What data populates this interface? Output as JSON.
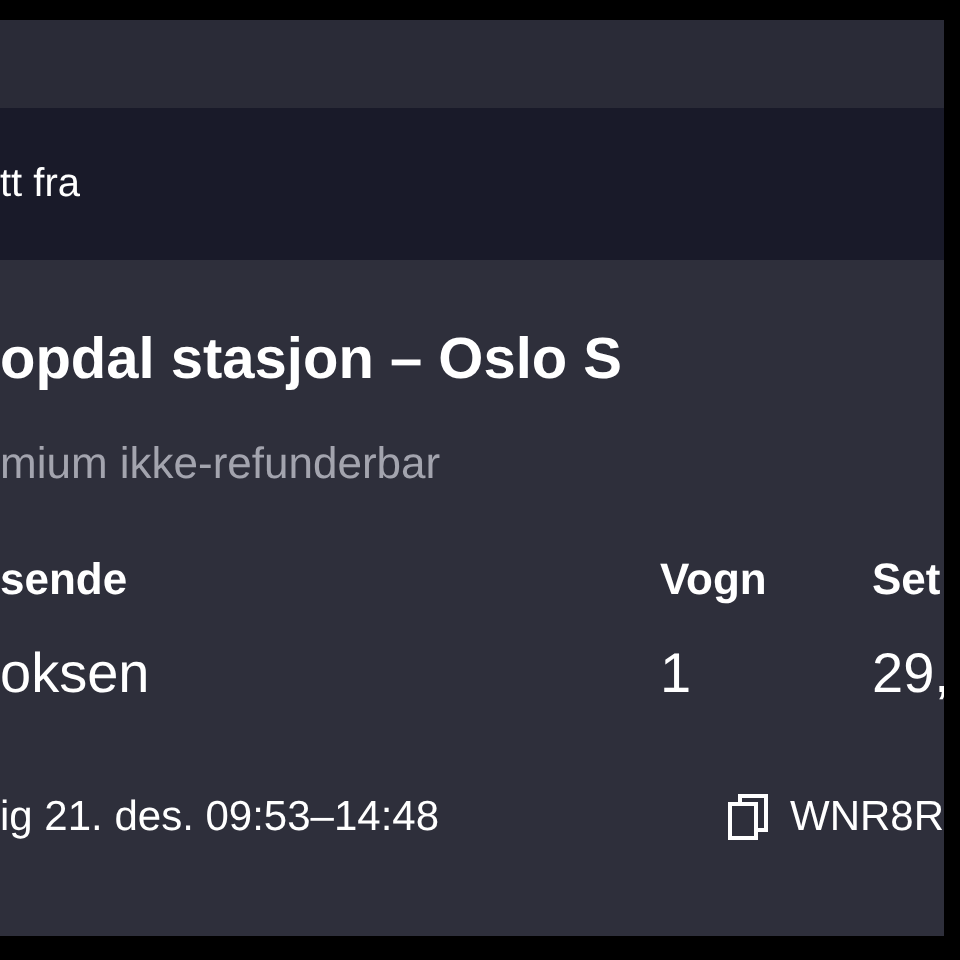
{
  "header": {
    "title": "tt fra"
  },
  "ticket": {
    "route": "opdal stasjon – Oslo S",
    "fare": "mium ikke-refunderbar",
    "fields": [
      {
        "label": "sende",
        "value": "oksen"
      },
      {
        "label": "Vogn",
        "value": "1"
      },
      {
        "label": "Set",
        "value": "29,"
      }
    ],
    "time": "ig 21. des. 09:53–14:48",
    "code": "WNR8R"
  }
}
